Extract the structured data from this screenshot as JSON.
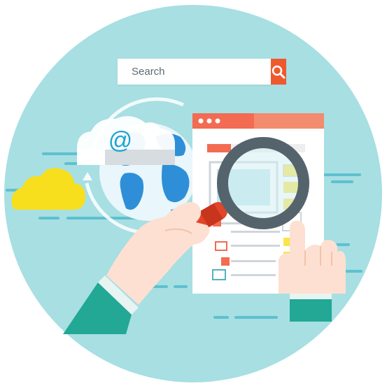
{
  "search": {
    "placeholder": "Search",
    "button_icon": "search-icon"
  },
  "email_cloud": {
    "symbol": "@",
    "icon": "at-sign-icon"
  },
  "browser_window": {
    "icon": "browser-window-icon",
    "control_dots": 3
  },
  "illustration": {
    "icons": [
      "cloud-icon",
      "globe-icon",
      "refresh-arrow-icon",
      "magnifying-glass-icon",
      "pointing-hand-icon",
      "hand-icon"
    ]
  },
  "colors": {
    "circle_background": "#a7dfe3",
    "accent_orange": "#ee5a2e",
    "browser_header": "#f26b52",
    "globe_blue": "#2e8fd8",
    "cloud_yellow": "#f7df1e",
    "sleeve_teal": "#22a894",
    "magnifier_frame": "#55646c",
    "magnifier_handle": "#e2452a"
  }
}
